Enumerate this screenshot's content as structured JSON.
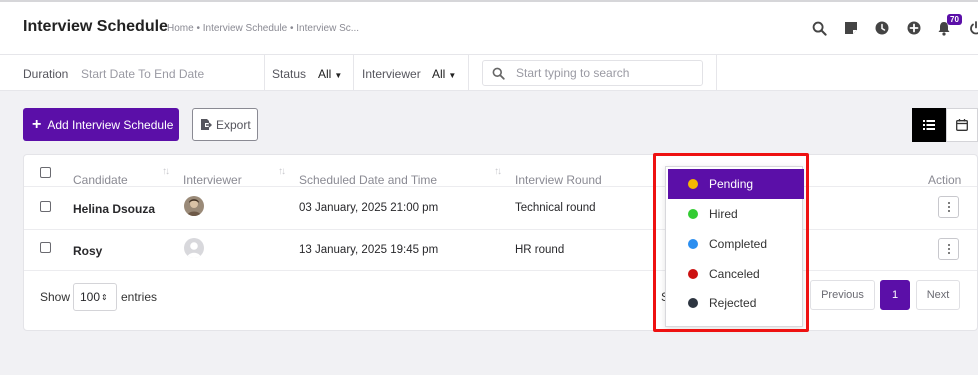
{
  "header": {
    "title": "Interview Schedule",
    "breadcrumb": "Home • Interview Schedule • Interview Sc...",
    "notification_count": "70",
    "icons": [
      "search-icon",
      "notes-icon",
      "clock-icon",
      "add-circle-icon",
      "bell-icon",
      "power-icon"
    ]
  },
  "filters": {
    "duration_label": "Duration",
    "duration_placeholder": "Start Date To End Date",
    "status_label": "Status",
    "status_value": "All",
    "interviewer_label": "Interviewer",
    "interviewer_value": "All",
    "search_placeholder": "Start typing to search"
  },
  "toolbar": {
    "add_label": "Add Interview Schedule",
    "export_label": "Export"
  },
  "table": {
    "columns": [
      "Candidate",
      "Interviewer",
      "Scheduled Date and Time",
      "Interview Round",
      "Action"
    ],
    "rows": [
      {
        "candidate": "Helina Dsouza",
        "datetime": "03 January, 2025 21:00 pm",
        "round": "Technical round"
      },
      {
        "candidate": "Rosy",
        "datetime": "13 January, 2025 19:45 pm",
        "round": "HR round"
      }
    ]
  },
  "footer": {
    "show_label": "Show",
    "entries_value": "100",
    "entries_label": "entries",
    "partial_text": "S",
    "previous_label": "Previous",
    "current_page": "1",
    "next_label": "Next"
  },
  "status_dropdown": {
    "items": [
      {
        "label": "Pending",
        "color": "#f5b800",
        "selected": true
      },
      {
        "label": "Hired",
        "color": "#33cc33",
        "selected": false
      },
      {
        "label": "Completed",
        "color": "#2b8ef0",
        "selected": false
      },
      {
        "label": "Canceled",
        "color": "#cc1111",
        "selected": false
      },
      {
        "label": "Rejected",
        "color": "#2d3540",
        "selected": false
      }
    ]
  },
  "colors": {
    "brand": "#5b0fa8",
    "highlight": "#ee1111"
  }
}
